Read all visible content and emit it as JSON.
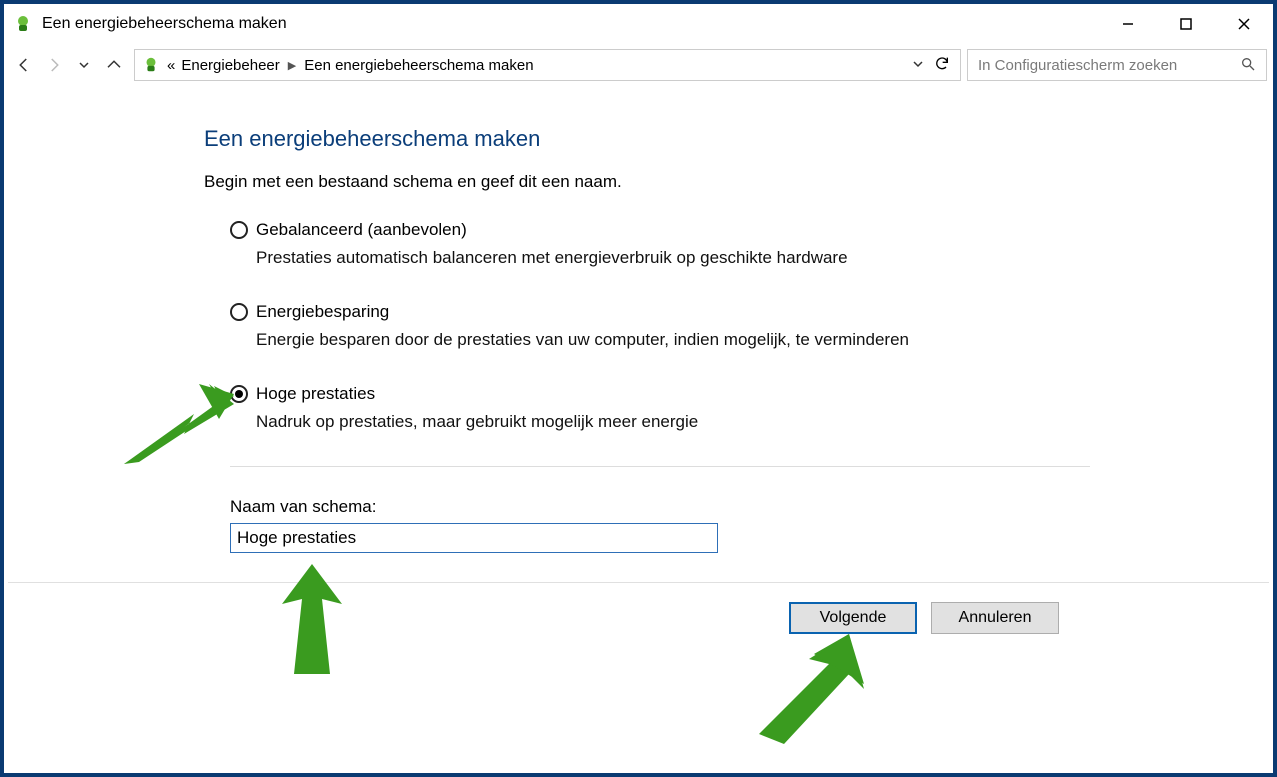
{
  "titlebar": {
    "title": "Een energiebeheerschema maken"
  },
  "breadcrumb": {
    "root_prefix": "«",
    "items": [
      "Energiebeheer",
      "Een energiebeheerschema maken"
    ]
  },
  "search": {
    "placeholder": "In Configuratiescherm zoeken"
  },
  "page": {
    "title": "Een energiebeheerschema maken",
    "subtitle": "Begin met een bestaand schema en geef dit een naam."
  },
  "options": [
    {
      "label": "Gebalanceerd (aanbevolen)",
      "description": "Prestaties automatisch balanceren met energieverbruik op geschikte hardware",
      "selected": false
    },
    {
      "label": "Energiebesparing",
      "description": "Energie besparen door de prestaties van uw computer, indien mogelijk, te verminderen",
      "selected": false
    },
    {
      "label": "Hoge prestaties",
      "description": "Nadruk op prestaties, maar gebruikt mogelijk meer energie",
      "selected": true
    }
  ],
  "plan_name": {
    "label": "Naam van schema:",
    "value": "Hoge prestaties"
  },
  "buttons": {
    "next": "Volgende",
    "cancel": "Annuleren"
  }
}
